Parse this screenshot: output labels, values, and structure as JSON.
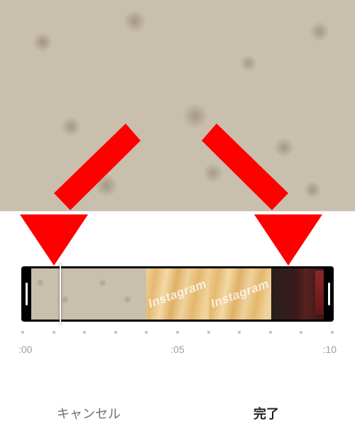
{
  "preview": {
    "progress_percent": 7
  },
  "trim": {
    "handles_color": "#000000",
    "playhead_position_sec": 0.9,
    "frames_watermark": "Instagram"
  },
  "ticks": {
    "count": 11,
    "labels": {
      "start": ":00",
      "mid": ":05",
      "end": ":10"
    }
  },
  "buttons": {
    "cancel": "キャンセル",
    "done": "完了"
  },
  "chart_data": {
    "type": "timeline",
    "unit": "seconds",
    "range": [
      0,
      10
    ],
    "trim_start": 0,
    "trim_end": 10,
    "playhead": 0.9,
    "tick_interval": 1
  }
}
